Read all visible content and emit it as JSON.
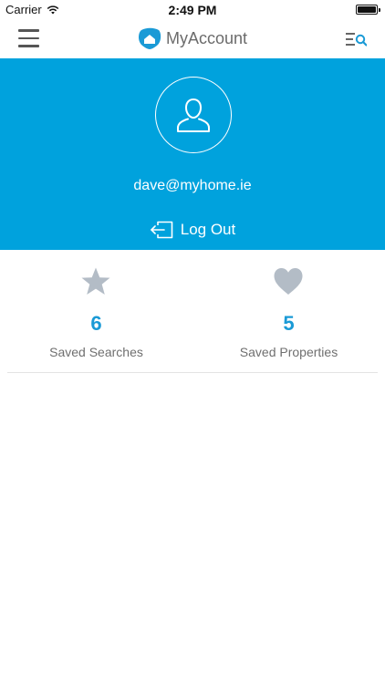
{
  "status_bar": {
    "carrier": "Carrier",
    "time": "2:49 PM"
  },
  "nav": {
    "title": "MyAccount",
    "brand_color": "#00a2dd"
  },
  "profile": {
    "email": "dave@myhome.ie",
    "logout_label": "Log Out",
    "header_color": "#00a2dd"
  },
  "stats": [
    {
      "icon": "star-icon",
      "count": "6",
      "label": "Saved Searches"
    },
    {
      "icon": "heart-icon",
      "count": "5",
      "label": "Saved Properties"
    }
  ],
  "colors": {
    "count_color": "#1a9ad6",
    "icon_color": "#b3bcc6"
  }
}
